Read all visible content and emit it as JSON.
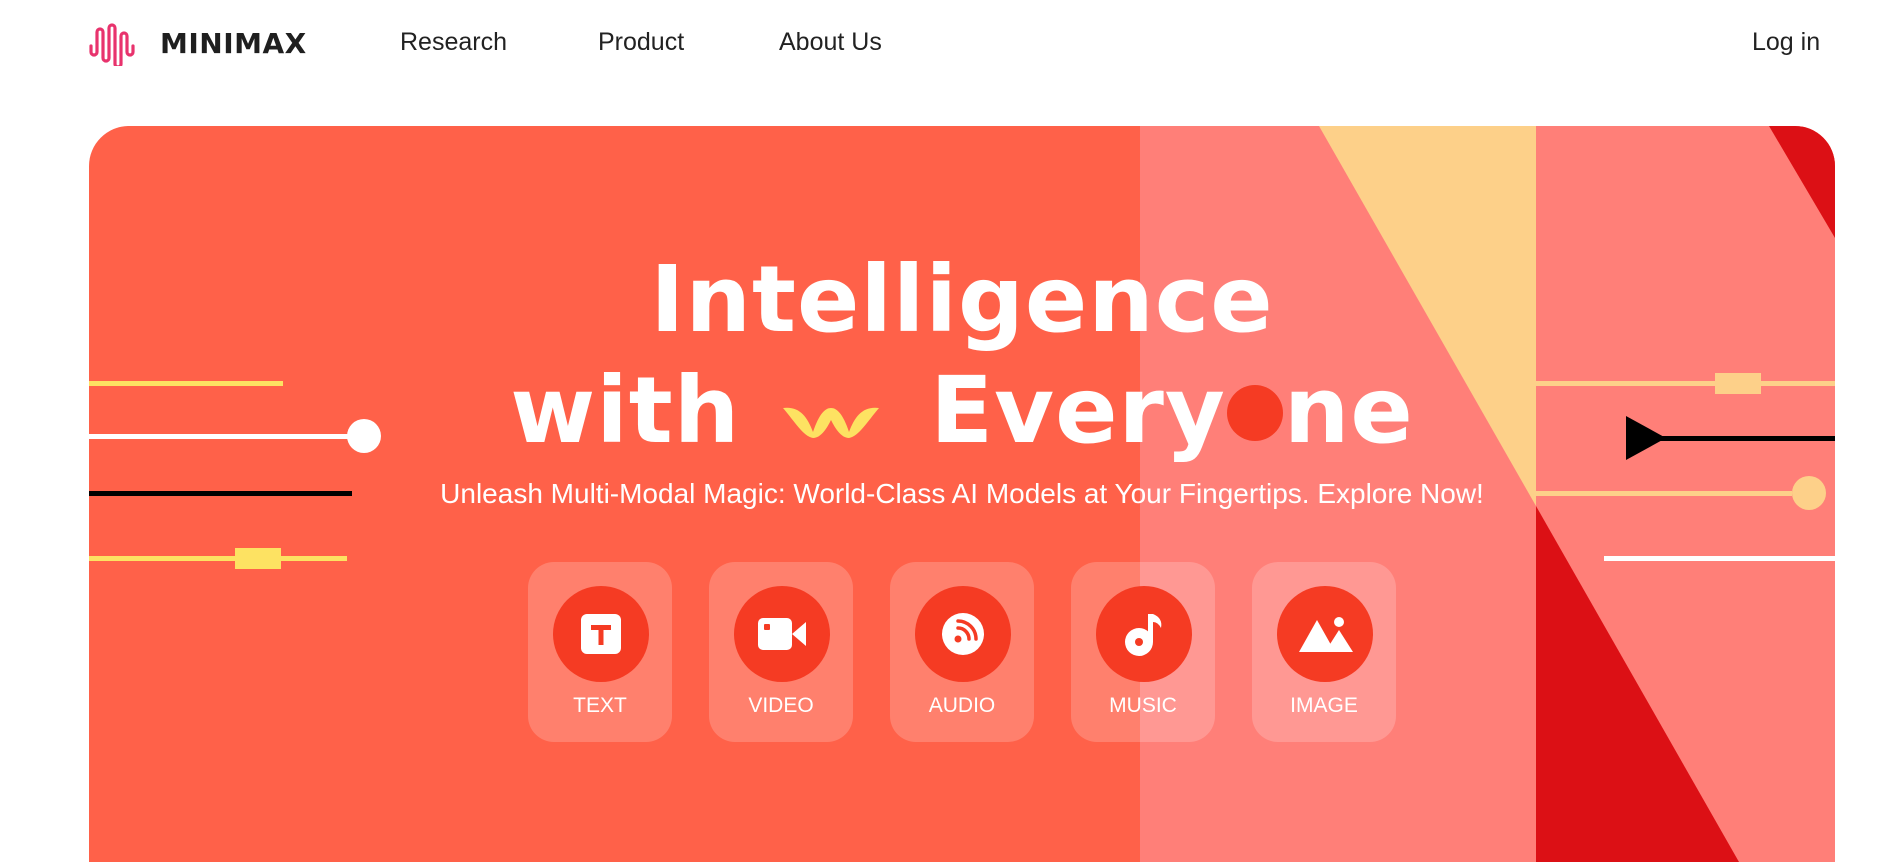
{
  "nav": {
    "logo_text": "MINIMAX",
    "links": [
      "Research",
      "Product",
      "About Us"
    ],
    "login": "Log in"
  },
  "hero": {
    "title_line1": "Intelligence",
    "title_with": "with",
    "title_every": "Every",
    "title_ne": "ne",
    "subtitle": "Unleash Multi-Modal Magic: World-Class AI Models at Your Fingertips. Explore Now!",
    "modalities": [
      {
        "label": "TEXT",
        "icon": "text-icon"
      },
      {
        "label": "VIDEO",
        "icon": "video-camera-icon"
      },
      {
        "label": "AUDIO",
        "icon": "audio-wave-icon"
      },
      {
        "label": "MUSIC",
        "icon": "music-note-icon"
      },
      {
        "label": "IMAGE",
        "icon": "mountain-image-icon"
      }
    ]
  },
  "colors": {
    "hero_bg": "#ff6149",
    "accent_red": "#f53b23",
    "panel_pink": "#ff7f78",
    "sand": "#fdd089",
    "dark_red": "#dc1015",
    "yellow": "#fde262"
  }
}
